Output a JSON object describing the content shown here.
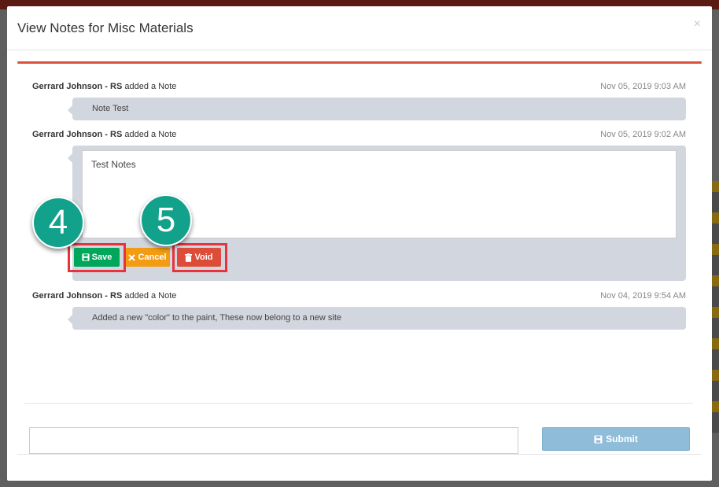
{
  "modal": {
    "title": "View Notes for Misc Materials",
    "close_label": "×"
  },
  "notes": [
    {
      "author": "Gerrard Johnson - ",
      "role": "RS",
      "action": " added a Note",
      "time": "Nov 05, 2019 9:03 AM",
      "text": "Note Test"
    },
    {
      "author": "Gerrard Johnson - ",
      "role": "RS",
      "action": " added a Note",
      "time": "Nov 05, 2019 9:02 AM",
      "text": "Test Notes"
    },
    {
      "author": "Gerrard Johnson - ",
      "role": "RS",
      "action": " added a Note",
      "time": "Nov 04, 2019 9:54 AM",
      "text": "Added a new \"color\" to the paint, These now belong to a new site"
    }
  ],
  "edit_buttons": {
    "save": "Save",
    "cancel": "Cancel",
    "void": "Void"
  },
  "callouts": [
    "4",
    "5"
  ],
  "footer": {
    "input_value": "",
    "submit_label": "Submit"
  },
  "icons": [
    "close-icon",
    "floppy-disk-icon",
    "times-icon",
    "trash-icon"
  ],
  "colors": {
    "accent_rule": "#d9503f",
    "save": "#00a65a",
    "cancel": "#f39c12",
    "void": "#dd4b39",
    "submit": "#8fbcd9",
    "callout": "#12a28c",
    "highlight": "#e8333c"
  }
}
